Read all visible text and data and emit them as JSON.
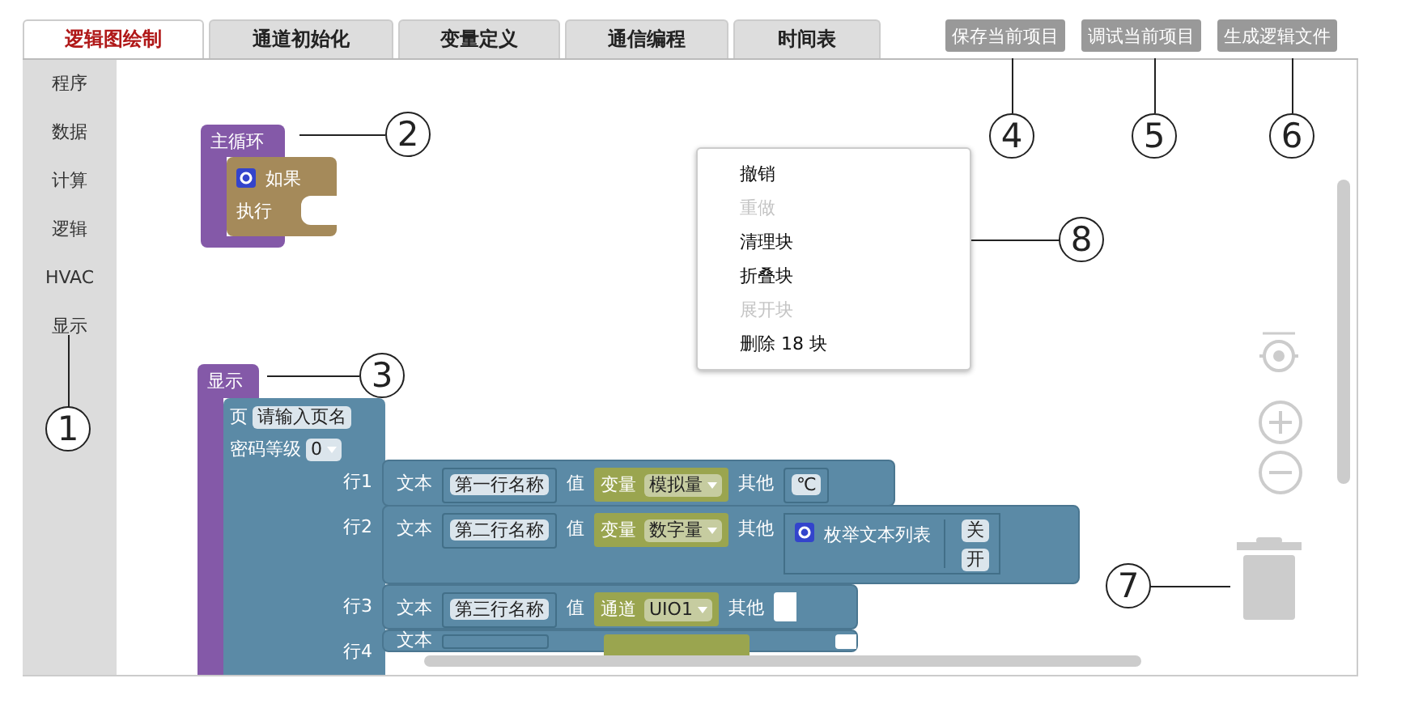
{
  "tabs": [
    {
      "label": "逻辑图绘制",
      "selected": true
    },
    {
      "label": "通道初始化",
      "selected": false
    },
    {
      "label": "变量定义",
      "selected": false
    },
    {
      "label": "通信编程",
      "selected": false
    },
    {
      "label": "时间表",
      "selected": false
    }
  ],
  "buttons": [
    "保存当前项目",
    "调试当前项目",
    "生成逻辑文件"
  ],
  "sidebar": {
    "items": [
      "程序",
      "数据",
      "计算",
      "逻辑",
      "HVAC",
      "显示"
    ]
  },
  "main_loop": {
    "label": "主循环",
    "if_label": "如果",
    "do_label": "执行"
  },
  "display": {
    "label": "显示",
    "page_label": "页",
    "page_name": "请输入页名",
    "password_label": "密码等级",
    "password_value": "0",
    "rows": [
      {
        "label": "行1",
        "text_label": "文本",
        "name": "第一行名称",
        "value_label": "值",
        "source": "变量",
        "source_value": "模拟量",
        "other_label": "其他",
        "other": {
          "kind": "text",
          "value": "℃"
        }
      },
      {
        "label": "行2",
        "text_label": "文本",
        "name": "第二行名称",
        "value_label": "值",
        "source": "变量",
        "source_value": "数字量",
        "other_label": "其他",
        "other": {
          "kind": "enum",
          "label": "枚举文本列表",
          "items": [
            "关",
            "开"
          ]
        }
      },
      {
        "label": "行3",
        "text_label": "文本",
        "name": "第三行名称",
        "value_label": "值",
        "source": "通道",
        "source_value": "UIO1",
        "other_label": "其他",
        "other": {
          "kind": "empty"
        }
      },
      {
        "label": "行4",
        "text_label": "文本",
        "other": {
          "kind": "empty"
        }
      }
    ]
  },
  "context_menu": [
    {
      "label": "撤销",
      "disabled": false
    },
    {
      "label": "重做",
      "disabled": true
    },
    {
      "label": "清理块",
      "disabled": false
    },
    {
      "label": "折叠块",
      "disabled": false
    },
    {
      "label": "展开块",
      "disabled": true
    },
    {
      "label": "删除 18 块",
      "disabled": false
    }
  ],
  "callouts": [
    {
      "number": "1"
    },
    {
      "number": "2"
    },
    {
      "number": "3"
    },
    {
      "number": "4"
    },
    {
      "number": "5"
    },
    {
      "number": "6"
    },
    {
      "number": "7"
    },
    {
      "number": "8"
    }
  ]
}
